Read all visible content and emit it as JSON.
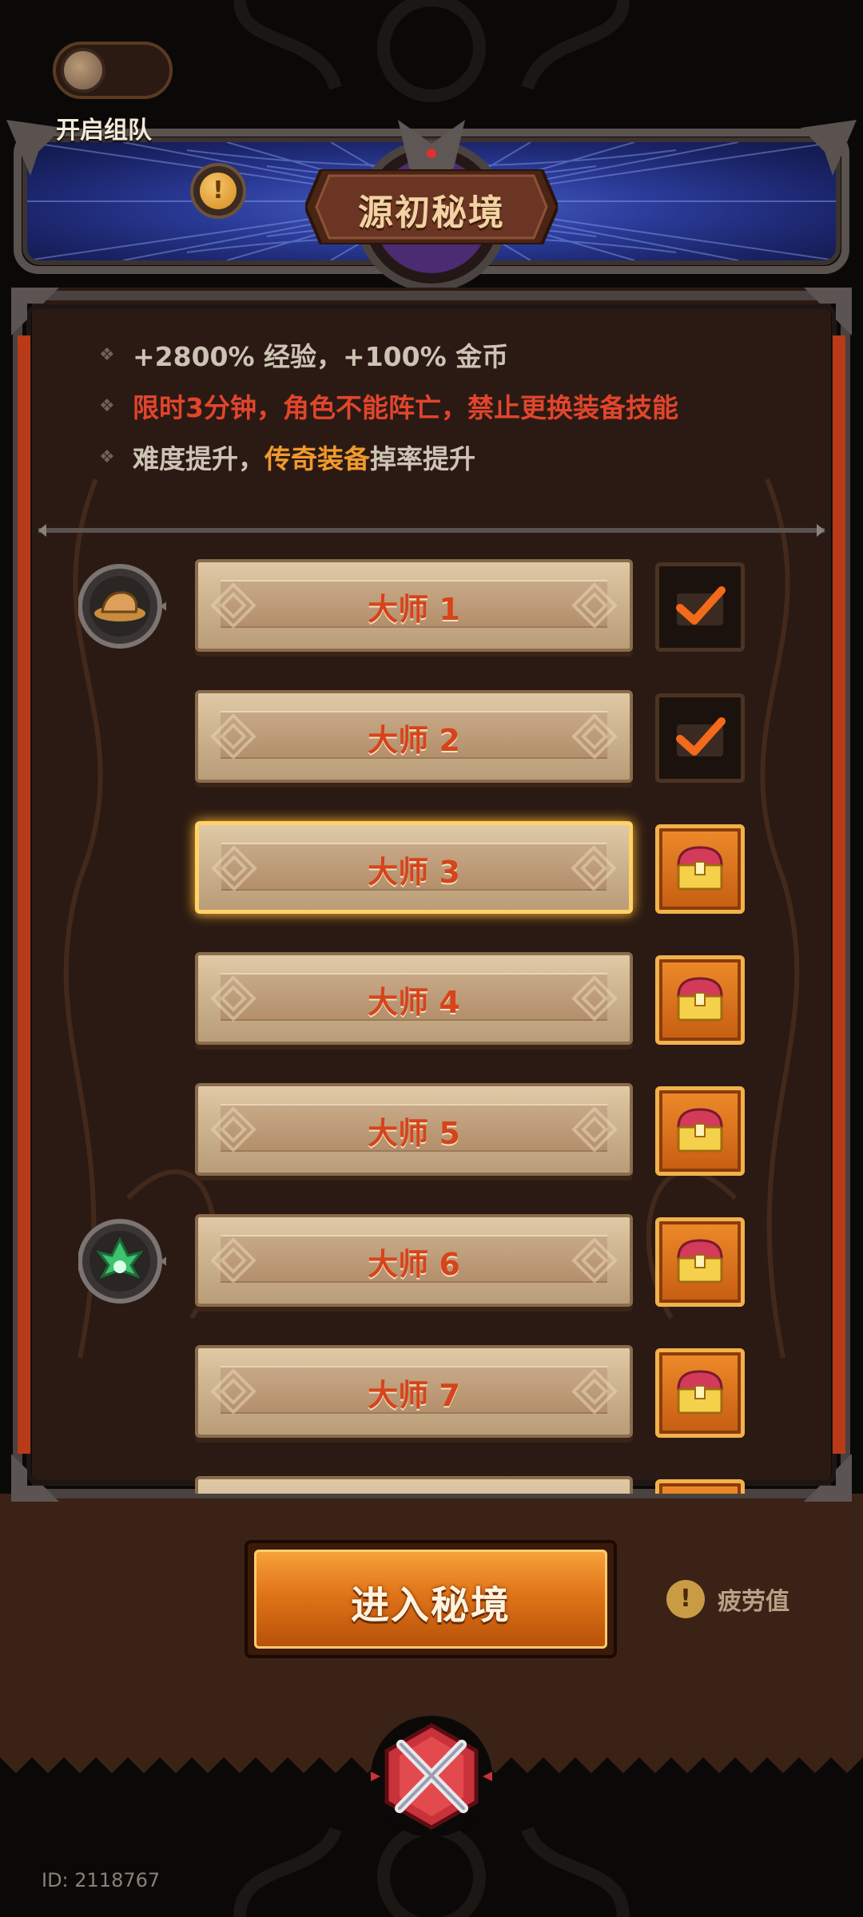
{
  "header": {
    "title": "源初秘境",
    "team_toggle_label": "开启组队",
    "team_toggle_on": false,
    "info_icon": "exclamation-icon"
  },
  "bullets": [
    {
      "text": "+2800% 经验，+100% 金币"
    },
    {
      "text": "限时3分钟，角色不能阵亡，禁止更换装备技能"
    },
    {
      "parts": [
        "难度提升，",
        "传奇装备",
        " 掉率提升"
      ]
    }
  ],
  "levels": [
    {
      "label": "大师 1",
      "reward": "done",
      "side_icon": "hat-icon"
    },
    {
      "label": "大师 2",
      "reward": "done"
    },
    {
      "label": "大师 3",
      "reward": "available",
      "selected": true
    },
    {
      "label": "大师 4",
      "reward": "available"
    },
    {
      "label": "大师 5",
      "reward": "available"
    },
    {
      "label": "大师 6",
      "reward": "available",
      "side_icon": "leaf-icon"
    },
    {
      "label": "大师 7",
      "reward": "available"
    },
    {
      "label": "",
      "reward": "available"
    }
  ],
  "footer": {
    "enter_label": "进入秘境",
    "fatigue_label": "疲劳值",
    "fatigue_icon": "exclamation-icon",
    "close_icon": "crossed-swords-icon",
    "user_id": "ID: 2118767"
  },
  "colors": {
    "accent_orange": "#e07418",
    "warning_red": "#e2452c",
    "legend_orange": "#f09a2e",
    "panel_bg": "#2a1a14",
    "banner_blue": "#2a3b98"
  }
}
